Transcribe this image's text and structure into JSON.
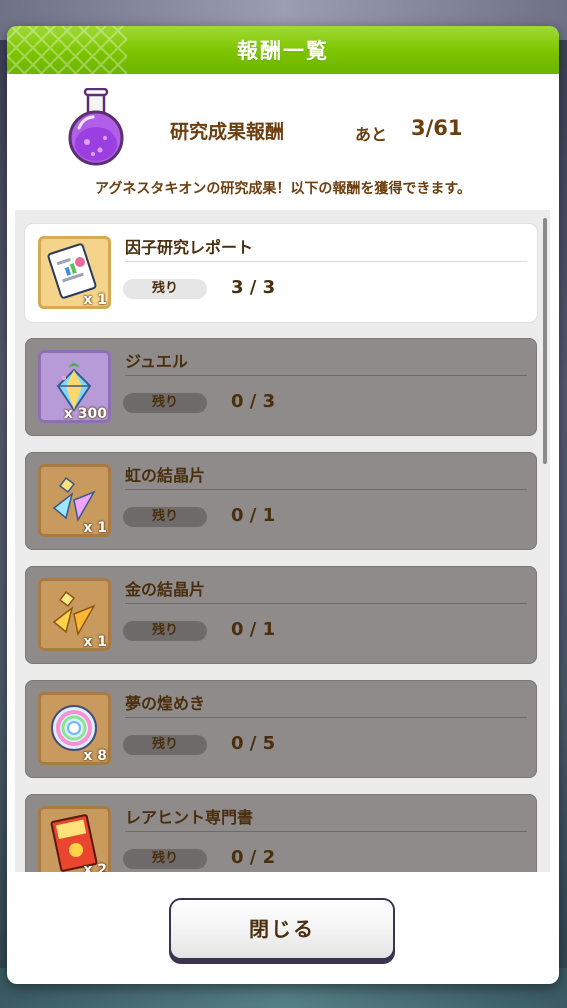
{
  "dialog": {
    "title": "報酬一覧",
    "reward_name": "研究成果報酬",
    "remain_label": "あと",
    "remain_value": "3/61",
    "description": "アグネスタキオンの研究成果！以下の報酬を獲得できます。",
    "close_label": "閉じる"
  },
  "items": [
    {
      "name": "因子研究レポート",
      "qty": "x 1",
      "remain_label": "残り",
      "count": "3 / 3",
      "icon": "report-icon"
    },
    {
      "name": "ジュエル",
      "qty": "x 300",
      "remain_label": "残り",
      "count": "0 / 3",
      "icon": "jewel-icon"
    },
    {
      "name": "虹の結晶片",
      "qty": "x 1",
      "remain_label": "残り",
      "count": "0 / 1",
      "icon": "rainbow-crystal-icon"
    },
    {
      "name": "金の結晶片",
      "qty": "x 1",
      "remain_label": "残り",
      "count": "0 / 1",
      "icon": "gold-crystal-icon"
    },
    {
      "name": "夢の煌めき",
      "qty": "x 8",
      "remain_label": "残り",
      "count": "0 / 5",
      "icon": "dream-sparkle-icon"
    },
    {
      "name": "レアヒント専門書",
      "qty": "x 2",
      "remain_label": "残り",
      "count": "0 / 2",
      "icon": "hint-book-icon"
    }
  ],
  "colors": {
    "header_green": "#7cc400",
    "text_brown": "#4a2f0e",
    "claimed_gray": "#8f8b8b"
  }
}
